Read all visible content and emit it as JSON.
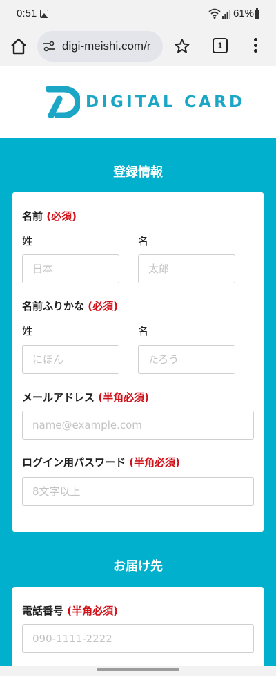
{
  "status_bar": {
    "time": "0:51",
    "battery": "61%"
  },
  "browser": {
    "url": "digi-meishi.com/r",
    "tab_count": "1"
  },
  "logo": {
    "text": "DIGITAL CARD",
    "color": "#1ca6c6"
  },
  "sections": {
    "registration": {
      "title": "登録情報",
      "name": {
        "label": "名前",
        "required": "(必須)",
        "last_label": "姓",
        "first_label": "名",
        "last_placeholder": "日本",
        "first_placeholder": "太郎"
      },
      "kana": {
        "label": "名前ふりかな",
        "required": "(必須)",
        "last_label": "姓",
        "first_label": "名",
        "last_placeholder": "にほん",
        "first_placeholder": "たろう"
      },
      "email": {
        "label": "メールアドレス",
        "required": "(半角必須)",
        "placeholder": "name@example.com"
      },
      "password": {
        "label": "ログイン用パスワード",
        "required": "(半角必須)",
        "placeholder": "8文字以上"
      }
    },
    "delivery": {
      "title": "お届け先",
      "phone": {
        "label": "電話番号",
        "required": "(半角必須)",
        "placeholder": "090-1111-2222"
      }
    }
  },
  "colors": {
    "teal": "#00b0cc",
    "required_red": "#d0121b"
  }
}
